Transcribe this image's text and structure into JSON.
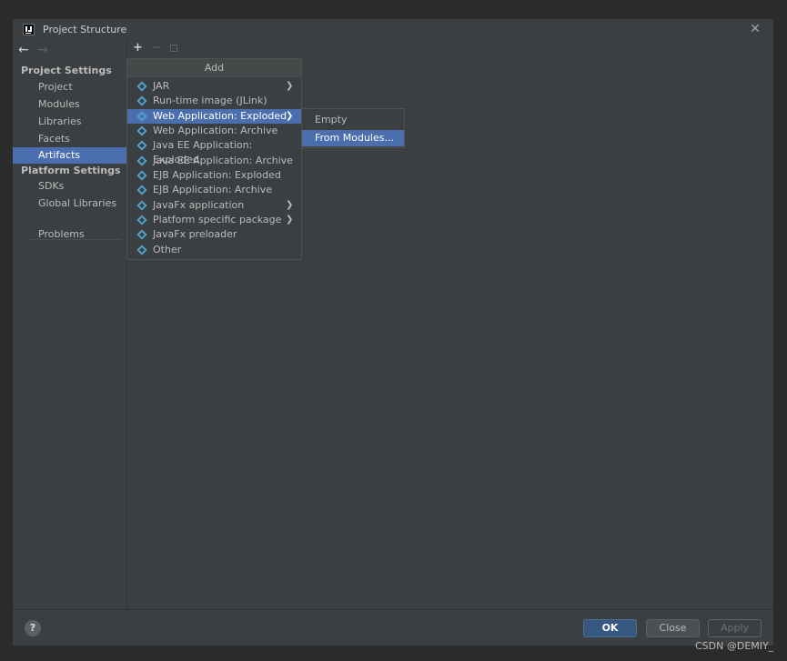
{
  "window": {
    "title": "Project Structure"
  },
  "nav": {
    "project_settings_header": "Project Settings",
    "project_items": [
      {
        "label": "Project"
      },
      {
        "label": "Modules"
      },
      {
        "label": "Libraries"
      },
      {
        "label": "Facets"
      },
      {
        "label": "Artifacts",
        "selected": true
      }
    ],
    "platform_settings_header": "Platform Settings",
    "platform_items": [
      {
        "label": "SDKs"
      },
      {
        "label": "Global Libraries"
      }
    ],
    "problems_label": "Problems"
  },
  "toolbar": {
    "add_icon": "plus-icon",
    "remove_icon": "minus-icon",
    "copy_icon": "copy-icon"
  },
  "add_popup": {
    "title": "Add",
    "items": [
      {
        "label": "JAR",
        "submenu": true
      },
      {
        "label": "Run-time image (JLink)"
      },
      {
        "label": "Web Application: Exploded",
        "submenu": true,
        "highlighted": true
      },
      {
        "label": "Web Application: Archive"
      },
      {
        "label": "Java EE Application: Exploded"
      },
      {
        "label": "Java EE Application: Archive"
      },
      {
        "label": "EJB Application: Exploded"
      },
      {
        "label": "EJB Application: Archive"
      },
      {
        "label": "JavaFx application",
        "submenu": true
      },
      {
        "label": "Platform specific package",
        "submenu": true
      },
      {
        "label": "JavaFx preloader"
      },
      {
        "label": "Other"
      }
    ]
  },
  "submenu": {
    "items": [
      {
        "label": "Empty"
      },
      {
        "label": "From Modules...",
        "highlighted": true
      }
    ]
  },
  "buttons": {
    "ok": "OK",
    "close": "Close",
    "apply": "Apply",
    "help": "?"
  },
  "watermark": "CSDN @DEMIY_",
  "colors": {
    "background": "#3c3f41",
    "selection": "#4b6eaf",
    "ok_button": "#365880"
  }
}
